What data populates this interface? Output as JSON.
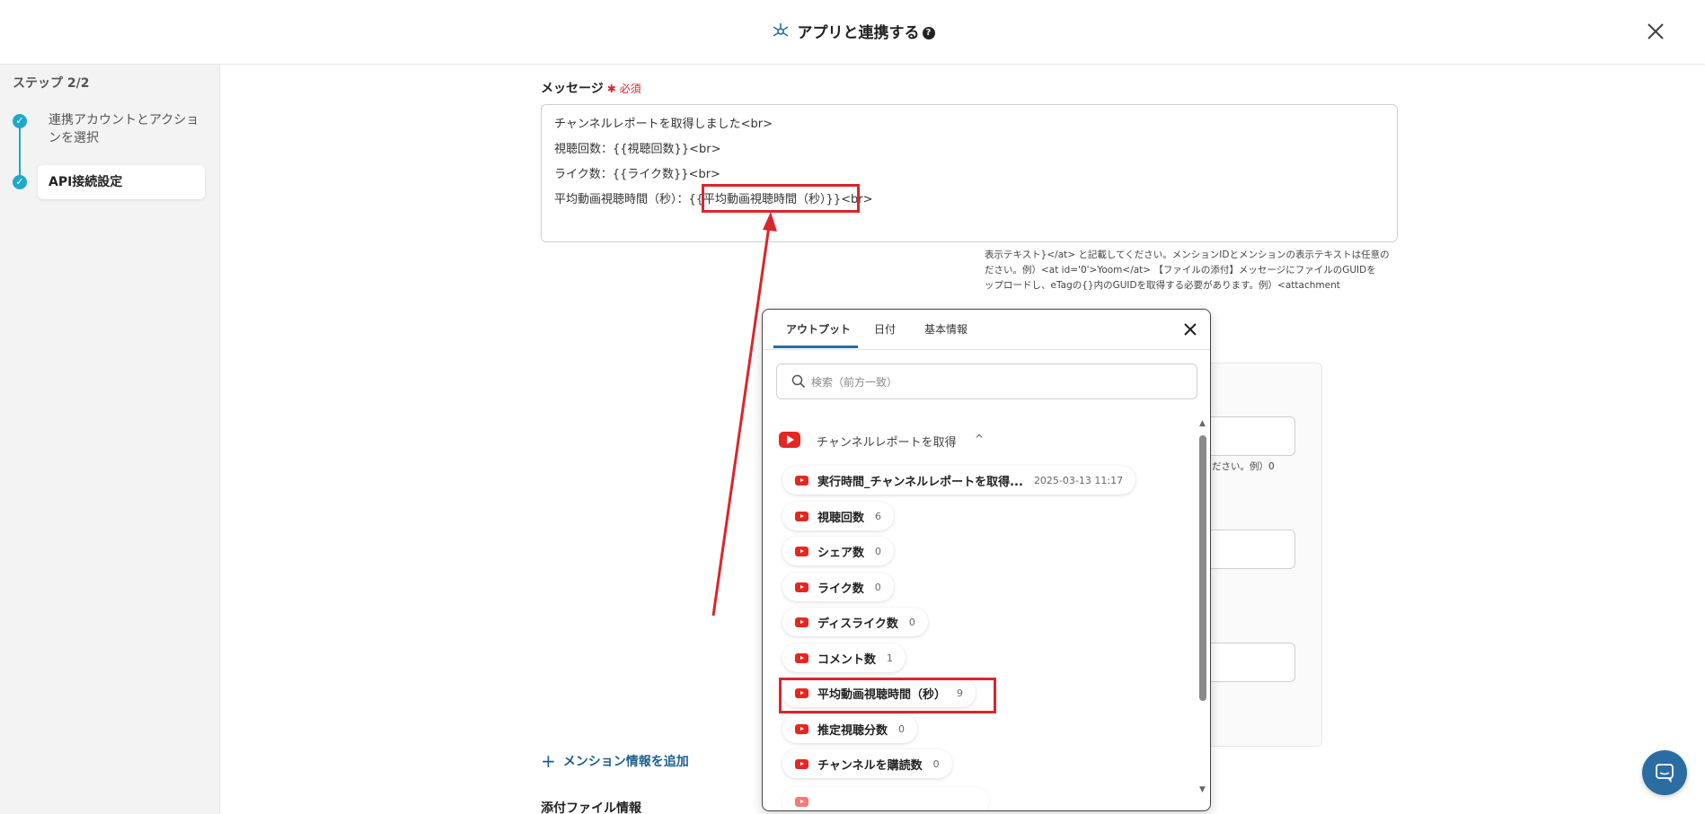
{
  "header": {
    "title": "アプリと連携する",
    "help": "?"
  },
  "sidebar": {
    "step": "ステップ 2/2",
    "items": [
      {
        "label": "連携アカウントとアクションを選択"
      },
      {
        "label": "API接続設定"
      }
    ]
  },
  "message": {
    "label": "メッセージ",
    "required": "必須",
    "lines": [
      "チャンネルレポートを取得しました<br>",
      "視聴回数：{{視聴回数}}<br>",
      "ライク数：{{ライク数}}<br>"
    ],
    "line4_prefix": "平均動画視聴時間（秒）：",
    "line4_var": "{{平均動画視聴時間（秒）}}",
    "line4_suffix": "<br>"
  },
  "help_text": {
    "line1": "表示テキスト}</at> と記載してください。メンションIDとメンションの表示テキストは任意の",
    "line2": "ださい。例）<at id='0'>Yoom</at> 【ファイルの添付】メッセージにファイルのGUIDを",
    "line3": "ップロードし、eTagの{}内のGUIDを取得する必要があります。例）<attachment",
    "note": "ださい。例）0"
  },
  "popup": {
    "tabs": [
      "アウトプット",
      "日付",
      "基本情報"
    ],
    "search_placeholder": "検索（前方一致）",
    "group": "チャンネルレポートを取得",
    "items": [
      {
        "label": "実行時間_チャンネルレポートを取得...",
        "value": "2025-03-13 11:17"
      },
      {
        "label": "視聴回数",
        "value": "6"
      },
      {
        "label": "シェア数",
        "value": "0"
      },
      {
        "label": "ライク数",
        "value": "0"
      },
      {
        "label": "ディスライク数",
        "value": "0"
      },
      {
        "label": "コメント数",
        "value": "1"
      },
      {
        "label": "平均動画視聴時間（秒）",
        "value": "9"
      },
      {
        "label": "推定視聴分数",
        "value": "0"
      },
      {
        "label": "チャンネルを購読数",
        "value": "0"
      }
    ]
  },
  "add_mention": "メンション情報を追加",
  "attach_label": "添付ファイル情報",
  "colors": {
    "accent": "#1fa8c9",
    "link": "#1d5f8f",
    "highlight": "#d9262b",
    "youtube": "#e52722"
  }
}
